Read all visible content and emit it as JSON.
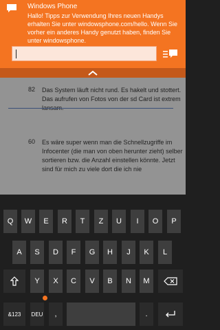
{
  "toast": {
    "title": "Windows Phone",
    "body": "Hallo! Tipps zur Verwendung Ihres neuen Handys erhalten Sie unter windowsphone.com/hello. Wenn Sie vorher ein anderes Handy genutzt haben, finden Sie unter windowsphone.",
    "reply_value": "",
    "accent": "#f47421"
  },
  "entries": [
    {
      "number": "82",
      "text": "Das System läuft nicht rund. Es hakelt und stottert. Das aufrufen von Fotos von der sd Card ist extrem lansam."
    },
    {
      "number": "60",
      "text": "Es wäre super wenn man die Schnellzugriffe im Infocenter (die man von oben herunter zieht) selber sortieren bzw. die Anzahl einstellen könnte. Jetzt sind für mich zu viele dort die ich nie"
    }
  ],
  "keyboard": {
    "row1": [
      "Q",
      "W",
      "E",
      "R",
      "T",
      "Z",
      "U",
      "I",
      "O",
      "P"
    ],
    "row2": [
      "A",
      "S",
      "D",
      "F",
      "G",
      "H",
      "J",
      "K",
      "L"
    ],
    "row3": [
      "Y",
      "X",
      "C",
      "V",
      "B",
      "N",
      "M"
    ],
    "symbols_label": "&123",
    "language_label": "DEU",
    "comma": ",",
    "period": "."
  },
  "icons": {
    "message": "message-icon",
    "reply": "reply-icon",
    "chevron": "chevron-up-icon",
    "shift": "shift-icon",
    "backspace": "backspace-icon",
    "emoji": "emoji-icon",
    "enter": "enter-icon"
  }
}
